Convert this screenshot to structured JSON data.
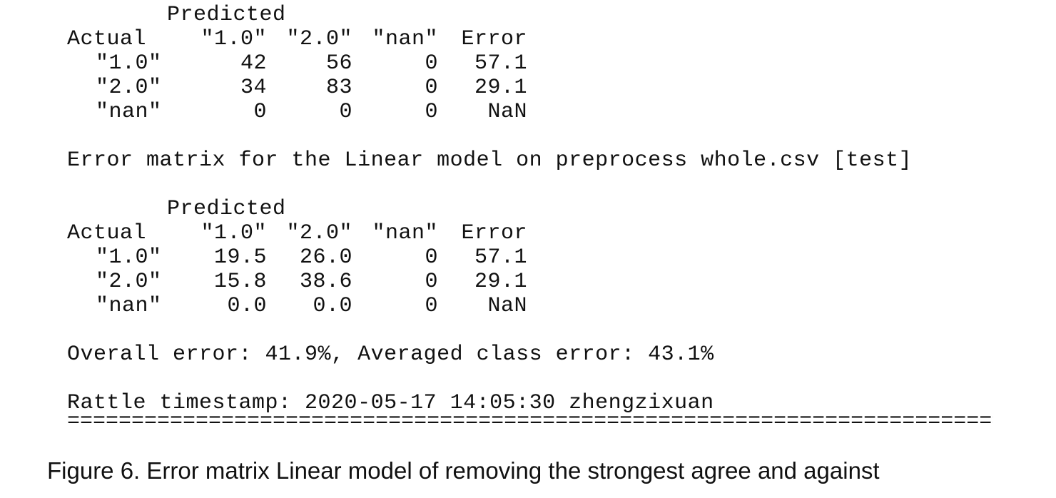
{
  "tables": [
    {
      "predicted_label": "Predicted",
      "actual_label": "Actual",
      "columns": [
        "\"1.0\"",
        "\"2.0\"",
        "\"nan\"",
        "Error"
      ],
      "rows": [
        {
          "label": "\"1.0\"",
          "cells": [
            "42",
            "56",
            "0",
            "57.1"
          ]
        },
        {
          "label": "\"2.0\"",
          "cells": [
            "34",
            "83",
            "0",
            "29.1"
          ]
        },
        {
          "label": "\"nan\"",
          "cells": [
            "0",
            "0",
            "0",
            "NaN"
          ]
        }
      ]
    },
    {
      "predicted_label": "Predicted",
      "actual_label": "Actual",
      "columns": [
        "\"1.0\"",
        "\"2.0\"",
        "\"nan\"",
        "Error"
      ],
      "rows": [
        {
          "label": "\"1.0\"",
          "cells": [
            "19.5",
            "26.0",
            "0",
            "57.1"
          ]
        },
        {
          "label": "\"2.0\"",
          "cells": [
            "15.8",
            "38.6",
            "0",
            "29.1"
          ]
        },
        {
          "label": "\"nan\"",
          "cells": [
            "0.0",
            "0.0",
            "0",
            "NaN"
          ]
        }
      ]
    }
  ],
  "matrix_title": "Error matrix for the Linear model on preprocess whole.csv [test]",
  "overall_error": "Overall error: 41.9%, Averaged class error: 43.1%",
  "timestamp": "Rattle timestamp: 2020-05-17 14:05:30 zhengzixuan",
  "rule": "========================================================================================",
  "caption": "Figure 6. Error matrix Linear model of removing the strongest agree and against"
}
